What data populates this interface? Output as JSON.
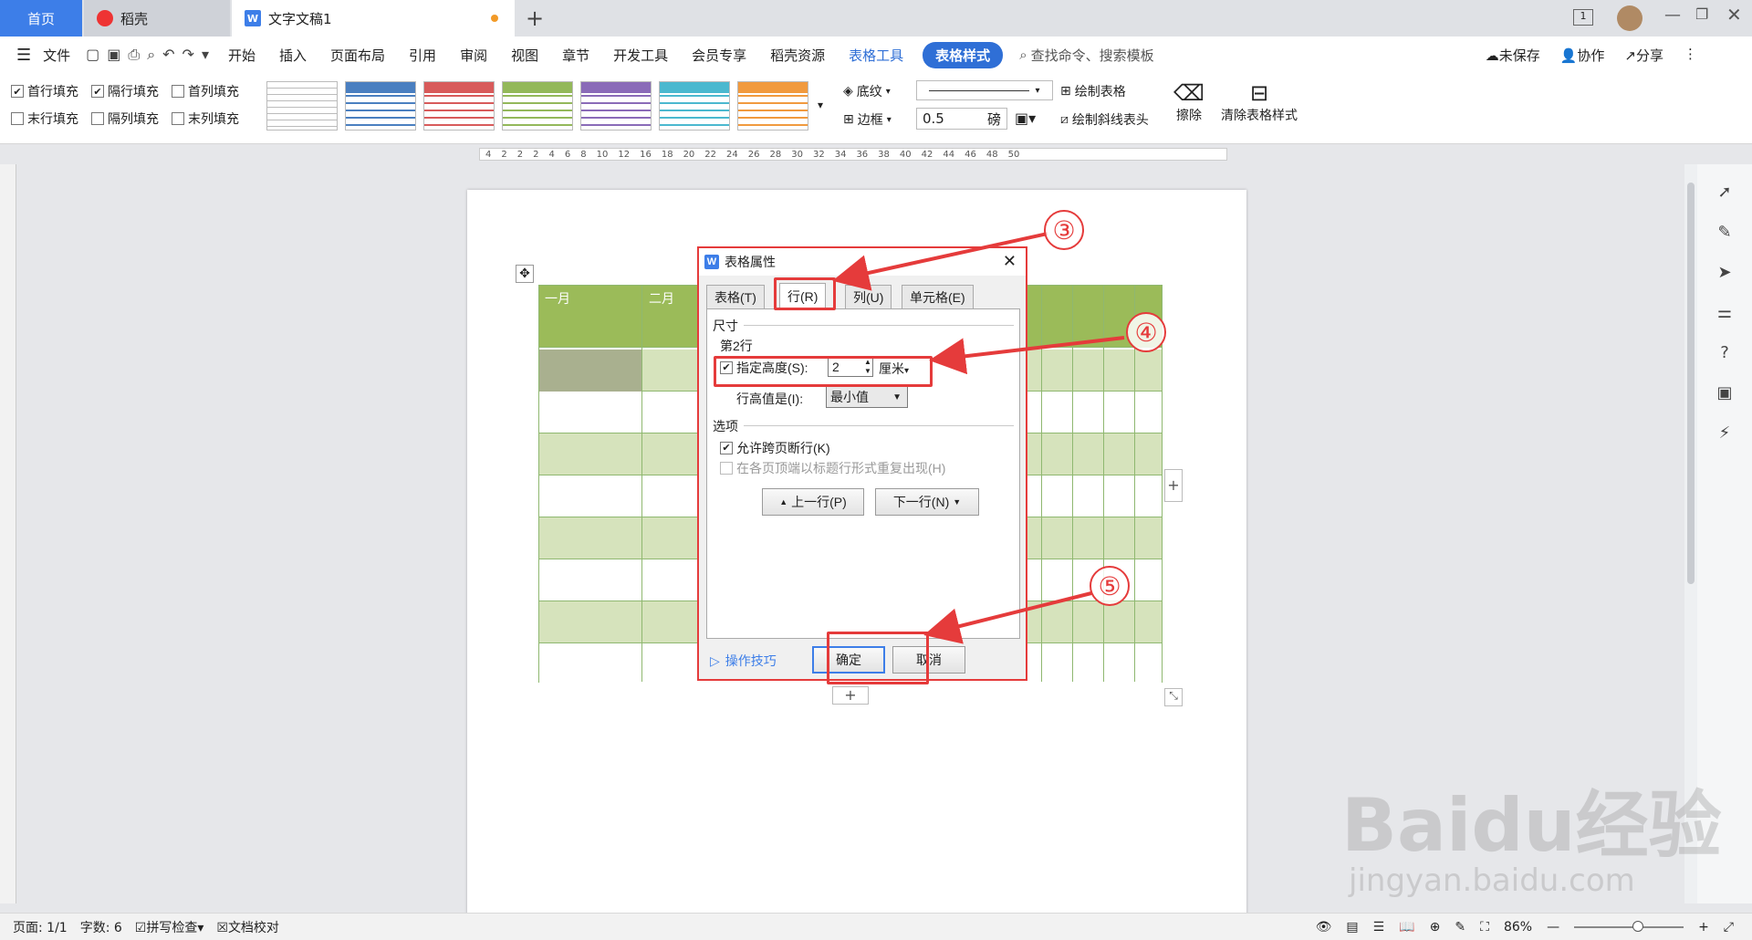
{
  "tabs": {
    "home": "首页",
    "daoke": "稻壳",
    "doc": "文字文稿1",
    "add": "+"
  },
  "menu": {
    "file": "文件",
    "items": [
      "开始",
      "插入",
      "页面布局",
      "引用",
      "审阅",
      "视图",
      "章节",
      "开发工具",
      "会员专享",
      "稻壳资源"
    ],
    "table_tools": "表格工具",
    "table_style": "表格样式",
    "search": "查找命令、搜索模板",
    "unsaved": "未保存",
    "collab": "协作",
    "share": "分享"
  },
  "toolbar": {
    "first_row_fill": "首行填充",
    "alt_row_fill": "隔行填充",
    "first_col_fill": "首列填充",
    "last_row_fill": "末行填充",
    "alt_col_fill": "隔列填充",
    "last_col_fill": "末列填充",
    "shading": "底纹",
    "border": "边框",
    "line_width": "0.5",
    "line_unit": "磅",
    "draw_table": "绘制表格",
    "draw_diagonal": "绘制斜线表头",
    "erase": "擦除",
    "clear_style": "清除表格样式",
    "style_colors": [
      "#ffffff",
      "#4a7fc0",
      "#d85b5b",
      "#93b85a",
      "#8a6bb8",
      "#4bb8cf",
      "#f19a3e"
    ]
  },
  "ruler": {
    "ticks": [
      "4",
      "2",
      "2",
      "2",
      "4",
      "6",
      "8",
      "10",
      "12",
      "16",
      "18",
      "20",
      "22",
      "24",
      "26",
      "28",
      "30",
      "32",
      "34",
      "36",
      "38",
      "40",
      "42",
      "44",
      "46",
      "48",
      "50"
    ]
  },
  "table": {
    "header": [
      "一月",
      "二月"
    ]
  },
  "dialog": {
    "title": "表格属性",
    "tabs": [
      "表格(T)",
      "行(R)",
      "列(U)",
      "单元格(E)"
    ],
    "size_group": "尺寸",
    "row_label": "第2行",
    "specify_height": "指定高度(S):",
    "height_value": "2",
    "height_unit": "厘米",
    "row_height_is": "行高值是(I):",
    "row_height_mode": "最小值",
    "options_group": "选项",
    "allow_break": "允许跨页断行(K)",
    "repeat_header": "在各页顶端以标题行形式重复出现(H)",
    "prev_row": "上一行(P)",
    "next_row": "下一行(N)",
    "tips": "操作技巧",
    "ok": "确定",
    "cancel": "取消"
  },
  "markers": {
    "m3": "③",
    "m4": "④",
    "m5": "⑤"
  },
  "status": {
    "page": "页面: 1/1",
    "words": "字数: 6",
    "spell": "拼写检查",
    "proof": "文档校对",
    "zoom": "86%"
  },
  "watermark": {
    "brand": "Bai",
    "brand2": "du",
    "brand3": "经验",
    "url": "jingyan.baidu.com"
  }
}
